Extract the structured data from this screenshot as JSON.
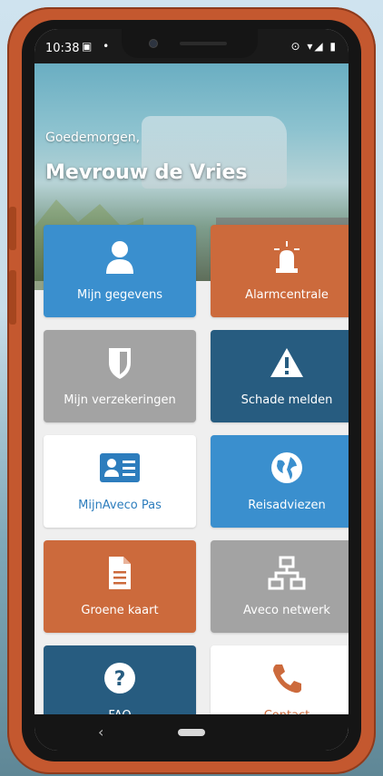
{
  "status": {
    "time": "10:38"
  },
  "hero": {
    "greeting": "Goedemorgen,",
    "name": "Mevrouw de Vries"
  },
  "tiles": [
    {
      "label": "Mijn gegevens",
      "icon": "user-icon"
    },
    {
      "label": "Alarmcentrale",
      "icon": "siren-icon"
    },
    {
      "label": "Mijn verzekeringen",
      "icon": "shield-icon"
    },
    {
      "label": "Schade melden",
      "icon": "warning-icon"
    },
    {
      "label": "MijnAveco Pas",
      "icon": "id-card-icon"
    },
    {
      "label": "Reisadviezen",
      "icon": "globe-icon"
    },
    {
      "label": "Groene kaart",
      "icon": "document-icon"
    },
    {
      "label": "Aveco netwerk",
      "icon": "network-icon"
    },
    {
      "label": "FAQ",
      "icon": "question-icon"
    },
    {
      "label": "Contact",
      "icon": "phone-icon"
    }
  ],
  "colors": {
    "blue": "#3a8fce",
    "orange": "#cc6a3c",
    "grey": "#a3a3a3",
    "navy": "#275c80",
    "phone_body": "#c4582f"
  }
}
